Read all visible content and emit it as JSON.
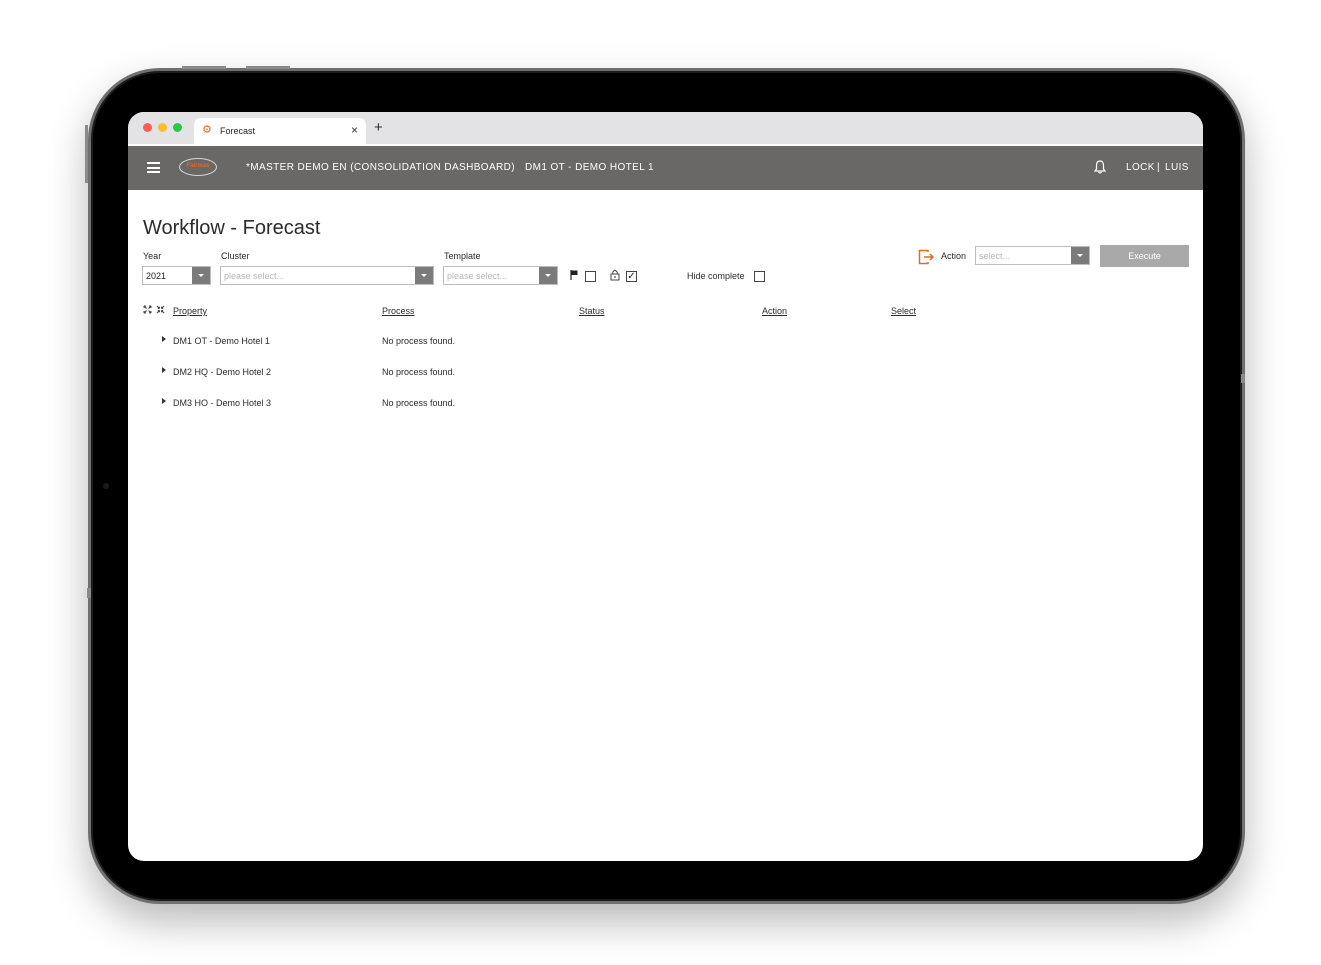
{
  "browser": {
    "tab_title": "Forecast",
    "tab_close": "×",
    "new_tab": "+"
  },
  "appbar": {
    "logo_text": "Fairmas",
    "company": "*MASTER DEMO EN (CONSOLIDATION DASHBOARD)",
    "hotel": "DM1 OT - DEMO HOTEL 1",
    "lock_label": "LOCK",
    "separator": "|",
    "user": "LUIS"
  },
  "page": {
    "title": "Workflow - Forecast"
  },
  "filters": {
    "year_label": "Year",
    "year_value": "2021",
    "cluster_label": "Cluster",
    "cluster_placeholder": "please select...",
    "template_label": "Template",
    "template_placeholder": "please select...",
    "hide_complete_label": "Hide complete",
    "action_label": "Action",
    "action_placeholder": "select...",
    "execute_label": "Execute"
  },
  "table": {
    "headers": {
      "property": "Property",
      "process": "Process",
      "status": "Status",
      "action": "Action",
      "select": "Select"
    },
    "rows": [
      {
        "property": "DM1 OT - Demo Hotel 1",
        "process": "No process found."
      },
      {
        "property": "DM2 HQ - Demo Hotel 2",
        "process": "No process found."
      },
      {
        "property": "DM3 HO - Demo Hotel 3",
        "process": "No process found."
      }
    ]
  },
  "colors": {
    "appbar": "#6a6866",
    "accent": "#e26b1e",
    "execute_button": "#a9a9a9"
  },
  "icons": {
    "tab": "gears-icon",
    "menu": "hamburger-icon",
    "notifications": "bell-icon",
    "action": "sign-out-icon",
    "flag": "flag-icon",
    "lock": "lock-icon",
    "expand_all": "expand-all-icon",
    "collapse_all": "collapse-all-icon"
  }
}
